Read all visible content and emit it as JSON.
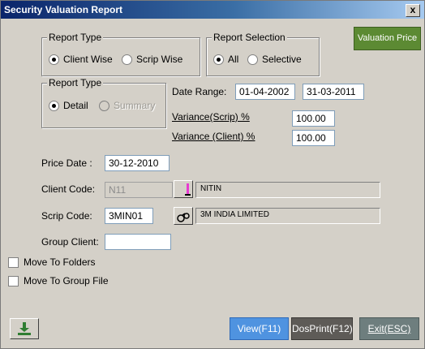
{
  "window": {
    "title": "Security Valuation Report",
    "close_glyph": "x"
  },
  "report_type_1": {
    "legend": "Report Type",
    "options": [
      {
        "label": "Client Wise",
        "selected": true
      },
      {
        "label": "Scrip Wise",
        "selected": false
      }
    ]
  },
  "report_selection": {
    "legend": "Report Selection",
    "options": [
      {
        "label": "All",
        "selected": true
      },
      {
        "label": "Selective",
        "selected": false
      }
    ]
  },
  "report_type_2": {
    "legend": "Report Type",
    "options": [
      {
        "label": "Detail",
        "selected": true
      },
      {
        "label": "Summary",
        "selected": false,
        "disabled": true
      }
    ]
  },
  "valuation_price_button": "Valuation Price",
  "date_range": {
    "label": "Date Range:",
    "from": "01-04-2002",
    "to": "31-03-2011"
  },
  "variance_scrip": {
    "label": "Variance(Scrip) %",
    "value": "100.00"
  },
  "variance_client": {
    "label": "Variance (Client) %",
    "value": "100.00"
  },
  "price_date": {
    "label": "Price Date :",
    "value": "30-12-2010"
  },
  "client_code": {
    "label": "Client Code:",
    "value": "N11",
    "name": "NITIN"
  },
  "scrip_code": {
    "label": "Scrip Code:",
    "value": "3MIN01",
    "name": "3M INDIA LIMITED"
  },
  "group_client": {
    "label": "Group Client:",
    "value": ""
  },
  "checkboxes": {
    "move_to_folders": "Move To Folders",
    "move_to_group_file": "Move To Group File"
  },
  "buttons": {
    "view": "View(F11)",
    "dosprint": "DosPrint(F12)",
    "exit": "Exit(ESC)"
  },
  "colors": {
    "title_start": "#0a246a",
    "title_end": "#a6caf0",
    "valuation": "#5c8a33",
    "view": "#4f93e0",
    "dosprint": "#5e5b57",
    "exit": "#6e7e7e"
  },
  "icons": {
    "client_lookup": "lookup-icon",
    "scrip_lookup": "binoculars-icon",
    "download": "download-icon"
  }
}
